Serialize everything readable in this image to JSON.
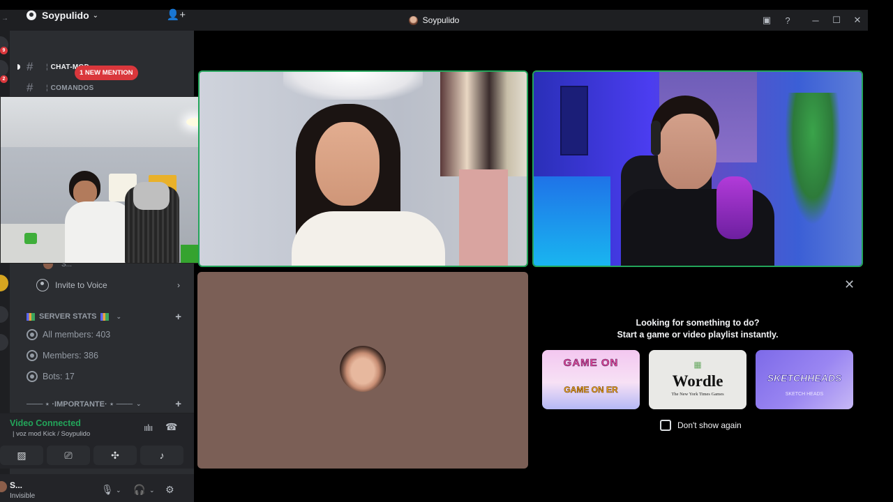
{
  "window": {
    "title": "Soypulido",
    "controls": [
      "inbox-icon",
      "help-icon",
      "minimize-icon",
      "maximize-icon",
      "close-icon"
    ]
  },
  "rail": {
    "badges": [
      "9",
      "2"
    ]
  },
  "server": {
    "name": "Soypulido"
  },
  "channels": [
    {
      "name": "CHAT-MOD",
      "unread": true
    },
    {
      "name": "COMANDOS",
      "unread": false
    }
  ],
  "mention_badge": "1 NEW MENTION",
  "voice_channel": {
    "user_label": "S...",
    "invite_label": "Invite to Voice"
  },
  "categories": {
    "server_stats": "SERVER STATS",
    "importante": "─── ⋆ ·IMPORTANTE· ⋆ ───"
  },
  "stats": [
    {
      "label": "All members: 403"
    },
    {
      "label": "Members: 386"
    },
    {
      "label": "Bots: 17"
    }
  ],
  "voice_panel": {
    "status": "Video Connected",
    "channel": "| voz mod Kick / Soypulido"
  },
  "user_panel": {
    "name": "S...",
    "status": "Invisible"
  },
  "activity": {
    "heading_line1": "Looking for something to do?",
    "heading_line2": "Start a game or video playlist instantly.",
    "cards": [
      {
        "title": "GAME ON",
        "sub": "GAME ON ER"
      },
      {
        "title": "Wordle",
        "sub": "The New York Times Games"
      },
      {
        "title": "SKETCHHEADS",
        "sub": "SKETCH HEADS"
      }
    ],
    "dont_show": "Don't show again"
  },
  "colors": {
    "speaking": "#23a55a",
    "mention": "#da373c",
    "connected": "#23a55a"
  }
}
